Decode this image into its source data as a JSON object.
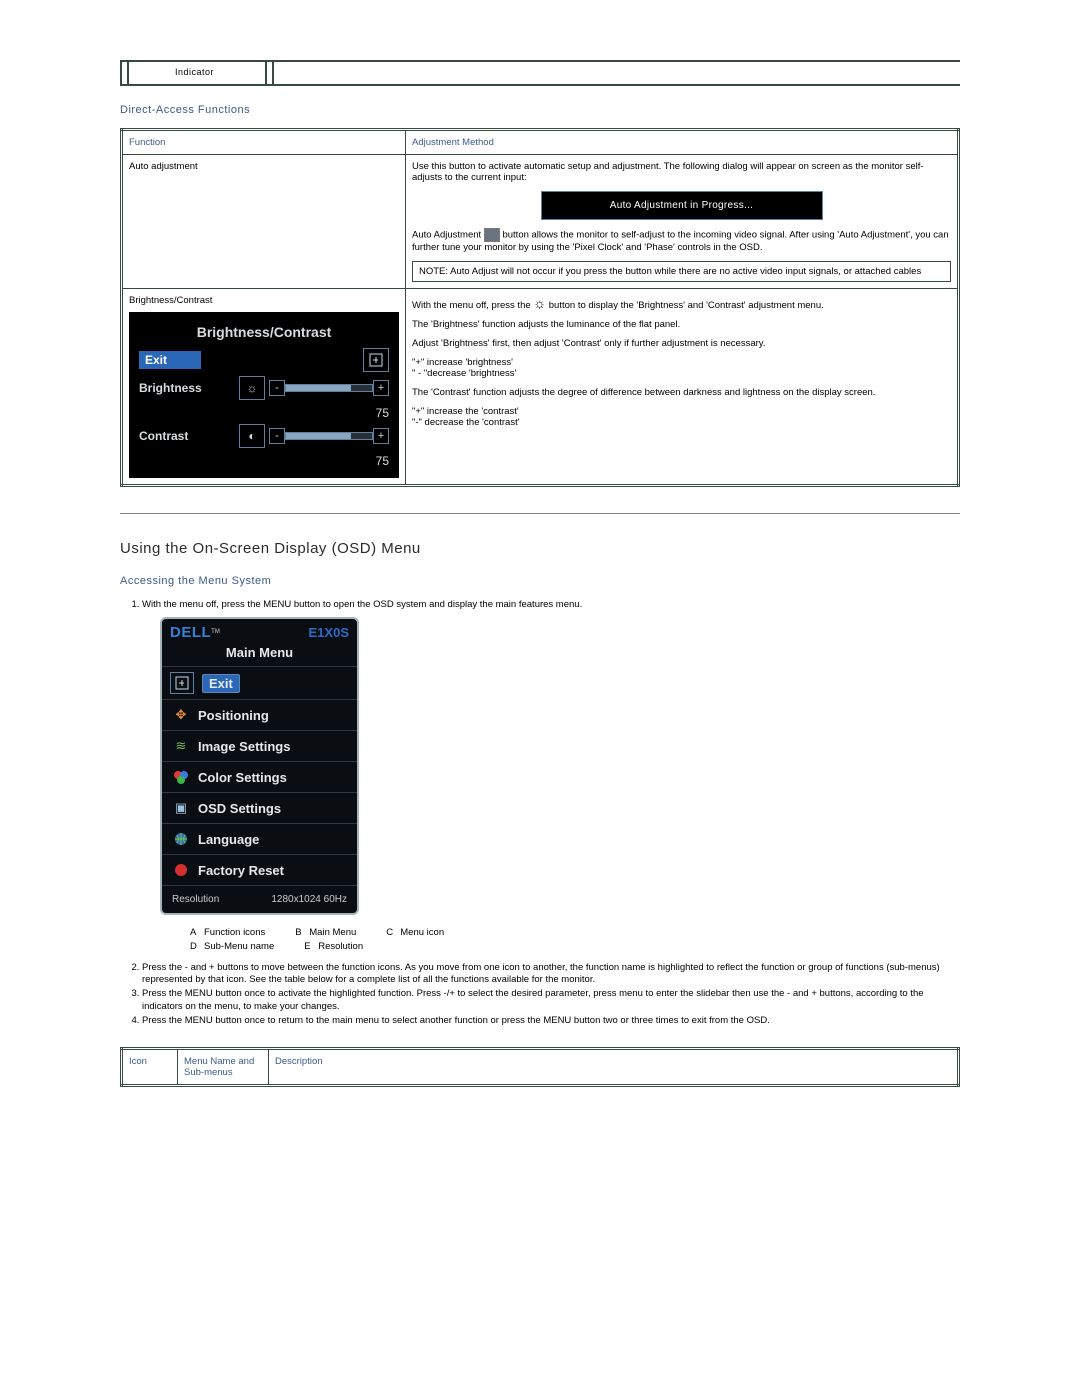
{
  "topbar": {
    "label": "Indicator"
  },
  "directAccess": {
    "heading": "Direct-Access Functions",
    "header": {
      "c1": "Function",
      "c2": "Adjustment Method"
    },
    "rows": [
      {
        "fn": "Auto adjustment",
        "top": "Use this button to activate automatic setup and adjustment. The following dialog will appear on screen as the monitor self-adjusts to the current input:",
        "box": "Auto Adjustment in Progress...",
        "mid": "Auto Adjustment button allows the monitor to self-adjust to the incoming video signal. After using 'Auto Adjustment', you can further tune your monitor by using the 'Pixel Clock' and 'Phase' controls in the OSD.",
        "note": "NOTE: Auto Adjust will not occur if you press the button while there are no active video input signals, or attached cables"
      },
      {
        "fn": "Brightness/Contrast",
        "osd": {
          "title": "Brightness/Contrast",
          "exit": "Exit",
          "b_label": "Brightness",
          "c_label": "Contrast",
          "b_val": "75",
          "c_val": "75"
        },
        "desc1": "With the menu off, press the ",
        "desc1b": " button to display the 'Brightness' and 'Contrast' adjustment menu.",
        "desc2": "The 'Brightness' function adjusts the luminance of the flat panel.",
        "desc3": "Adjust 'Brightness' first, then adjust 'Contrast' only if further adjustment is necessary.",
        "bplus": "\"+\" increase 'brightness'",
        "bminus": "\" - \"decrease 'brightness'",
        "desc4": "The 'Contrast' function adjusts the degree of difference between darkness and lightness on the display screen.",
        "cplus": "\"+\" increase the 'contrast'",
        "cminus": "\"-\" decrease the 'contrast'"
      }
    ]
  },
  "osdSection": {
    "heading": "Using the On-Screen Display (OSD) Menu",
    "sub": "Accessing the Menu System",
    "steps": [
      "With the menu off, press the MENU button to open the OSD system and display the main features menu.",
      "Press the - and + buttons to move between the function icons. As you move from one icon to another, the function name is highlighted to reflect the function or group of functions (sub-menus) represented by that icon. See the table below for a complete list of all the functions available for the monitor.",
      "Press the MENU button once to activate the highlighted function. Press -/+ to select the desired parameter, press menu to enter the slidebar then use the - and + buttons, according to the indicators on the menu, to make your changes.",
      "Press the MENU button once to return to the main menu to select another function or press the MENU button two or three times to exit from the OSD."
    ],
    "menu": {
      "brand": "DELL",
      "model": "E1X0S",
      "main": "Main Menu",
      "items": [
        {
          "name": "exit",
          "label": "Exit",
          "class": "exit"
        },
        {
          "name": "positioning",
          "label": "Positioning"
        },
        {
          "name": "image",
          "label": "Image Settings"
        },
        {
          "name": "color",
          "label": "Color Settings"
        },
        {
          "name": "osd",
          "label": "OSD Settings"
        },
        {
          "name": "language",
          "label": "Language"
        },
        {
          "name": "factory",
          "label": "Factory Reset"
        }
      ],
      "res_label": "Resolution",
      "res_value": "1280x1024 60Hz"
    },
    "legend": {
      "a": "Function icons",
      "b": "Main Menu",
      "c": "Menu icon",
      "d": "Sub-Menu name",
      "e": "Resolution"
    }
  },
  "bottomTable": {
    "c1": "Icon",
    "c2": "Menu Name and Sub-menus",
    "c3": "Description"
  }
}
